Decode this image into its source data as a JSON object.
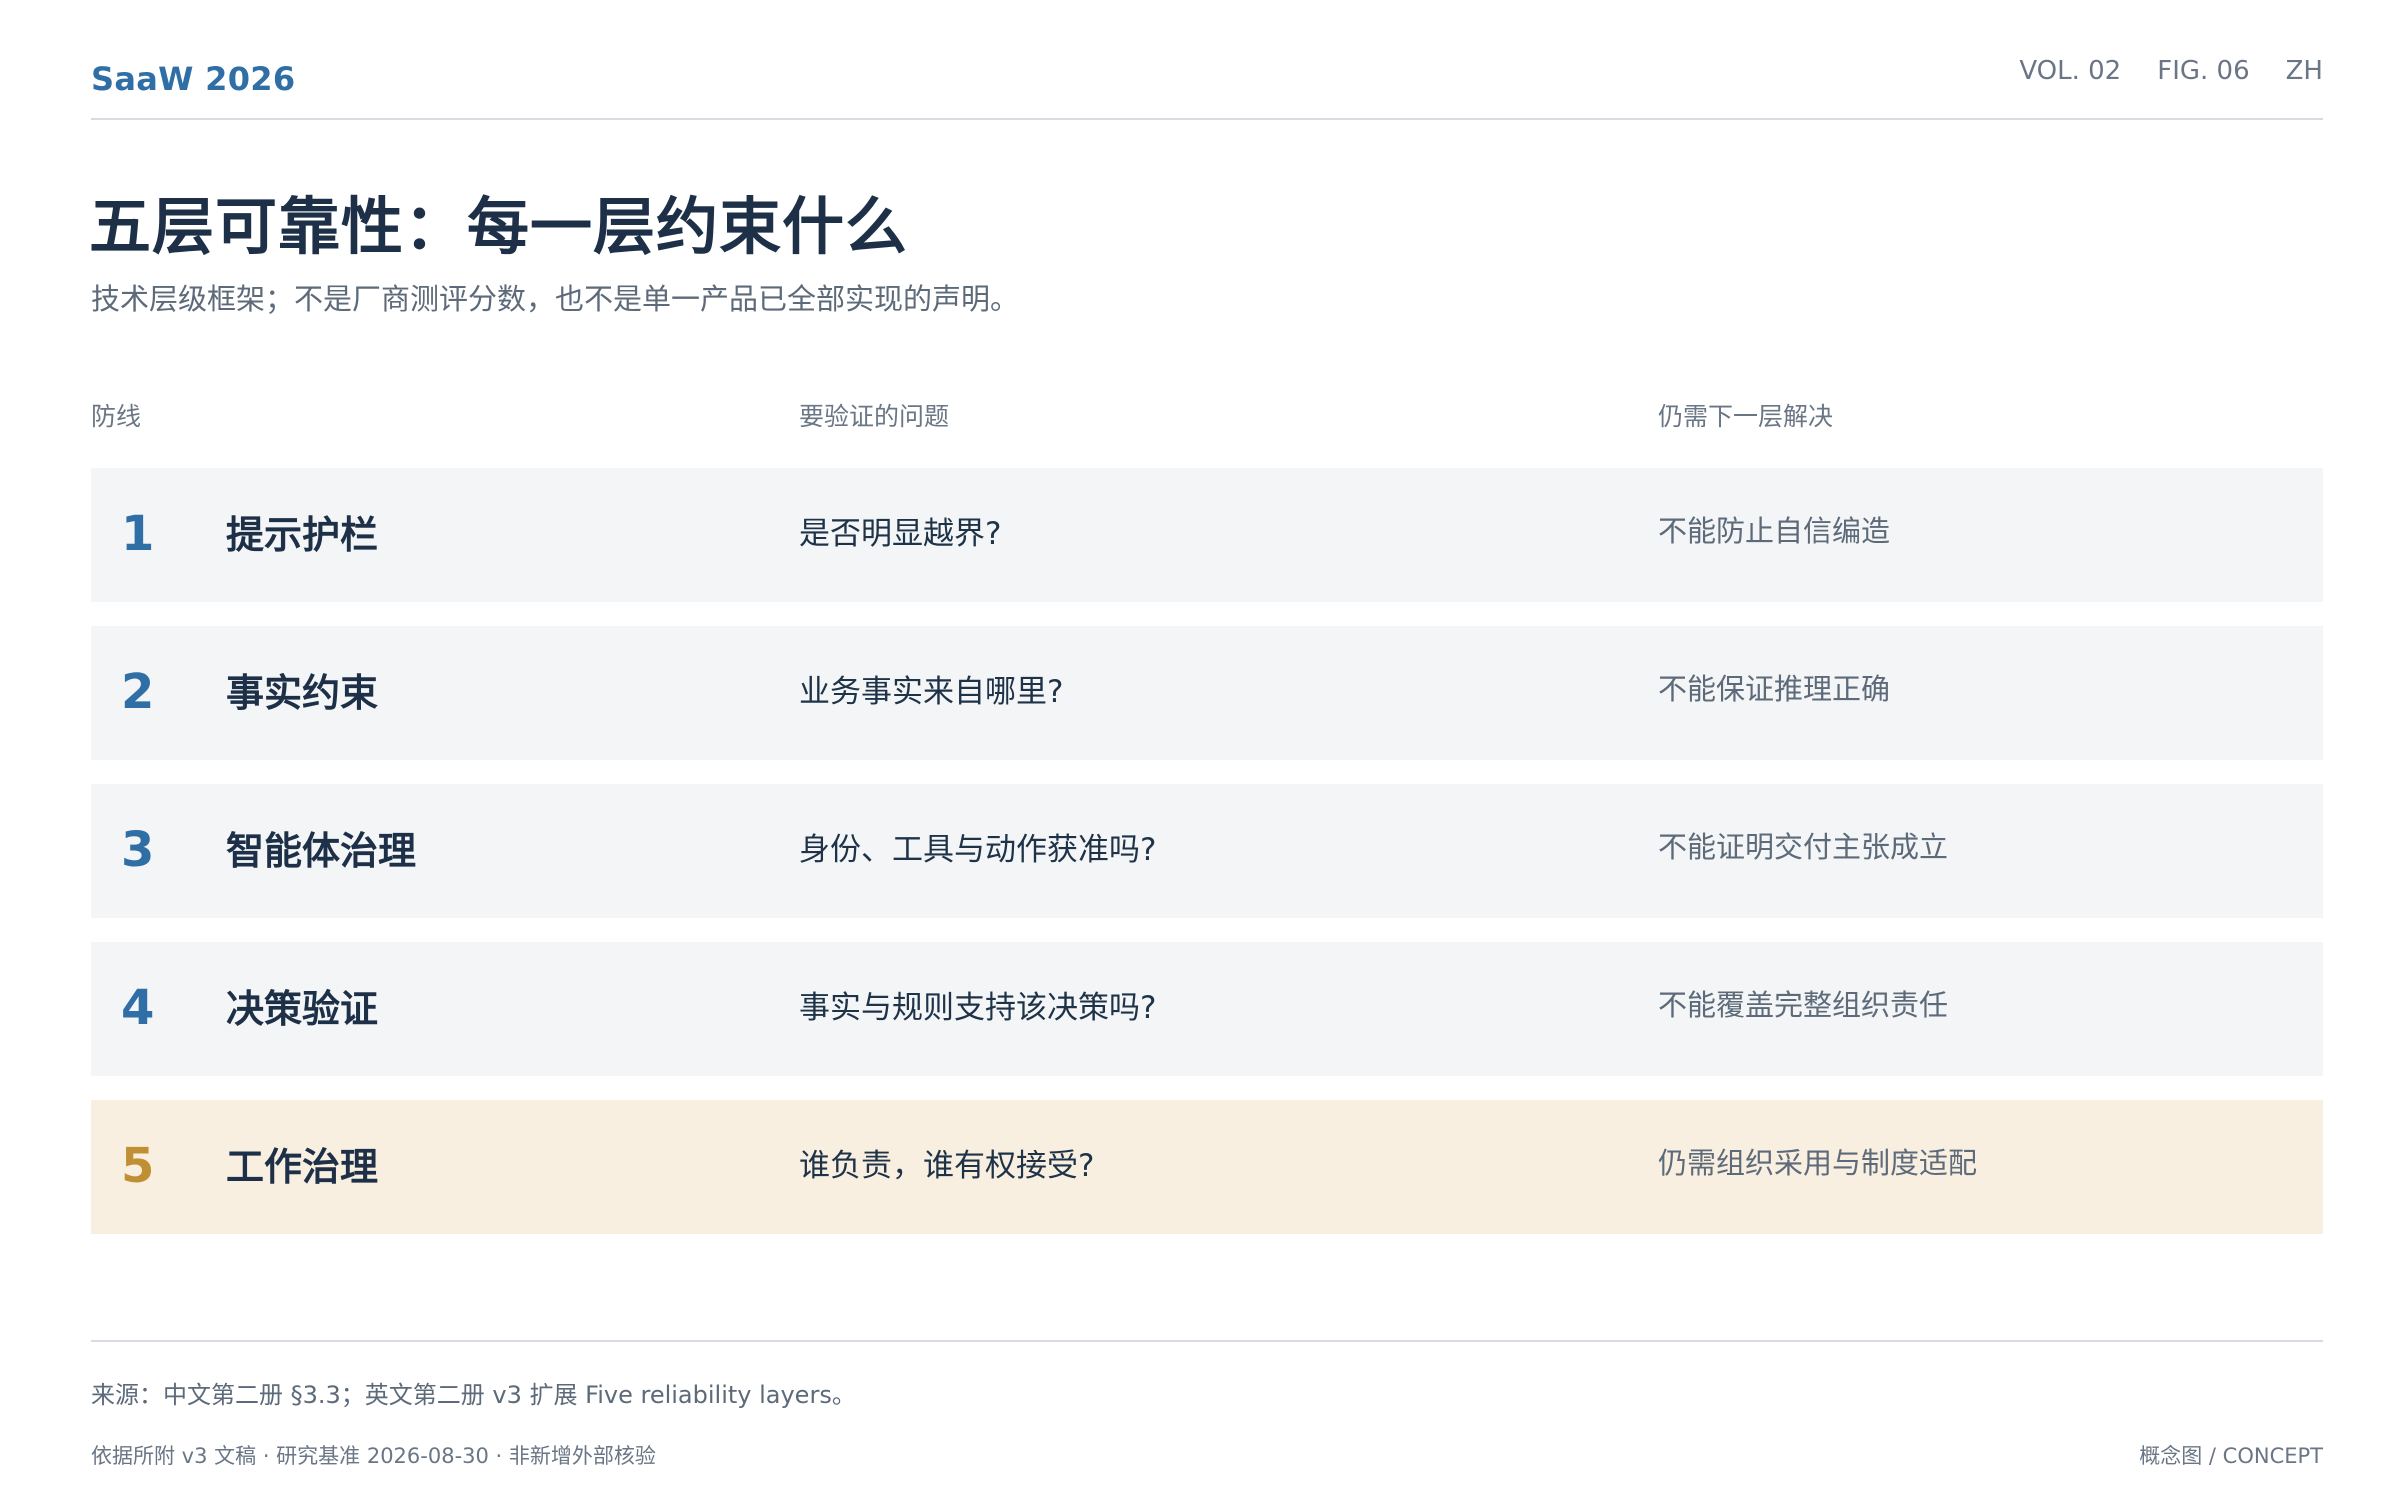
{
  "header": {
    "brand": "SaaW 2026",
    "meta": [
      "VOL. 02",
      "FIG. 06",
      "ZH"
    ]
  },
  "title": "五层可靠性：每一层约束什么",
  "subtitle": "技术层级框架；不是厂商测评分数，也不是单一产品已全部实现的声明。",
  "table": {
    "headers": [
      "防线",
      "要验证的问题",
      "仍需下一层解决"
    ],
    "rows": [
      {
        "num": "1",
        "name": "提示护栏",
        "question": "是否明显越界?",
        "remain": "不能防止自信编造"
      },
      {
        "num": "2",
        "name": "事实约束",
        "question": "业务事实来自哪里?",
        "remain": "不能保证推理正确"
      },
      {
        "num": "3",
        "name": "智能体治理",
        "question": "身份、工具与动作获准吗?",
        "remain": "不能证明交付主张成立"
      },
      {
        "num": "4",
        "name": "决策验证",
        "question": "事实与规则支持该决策吗?",
        "remain": "不能覆盖完整组织责任"
      },
      {
        "num": "5",
        "name": "工作治理",
        "question": "谁负责，谁有权接受?",
        "remain": "仍需组织采用与制度适配"
      }
    ]
  },
  "footer": {
    "source": "来源：中文第二册 §3.3；英文第二册 v3 扩展 Five reliability layers。",
    "note": "依据所附 v3 文稿 · 研究基准 2026-08-30 · 非新增外部核验",
    "concept": "概念图 / CONCEPT"
  },
  "colors": {
    "accent": "#2f6fa6",
    "highlight_accent": "#c08f33",
    "row_bg": "#f3f5f7",
    "highlight_bg": "#f8efe1"
  }
}
